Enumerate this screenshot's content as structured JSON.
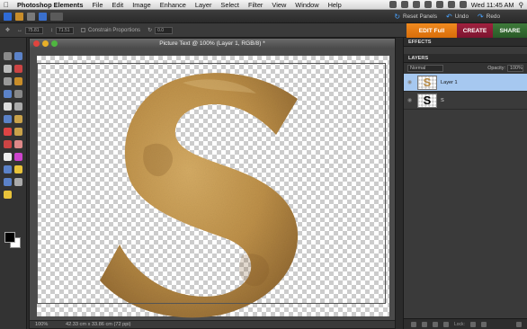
{
  "menubar": {
    "app_name": "Photoshop Elements",
    "items": [
      "File",
      "Edit",
      "Image",
      "Enhance",
      "Layer",
      "Select",
      "Filter",
      "View",
      "Window",
      "Help"
    ],
    "clock": "Wed 11:45 AM"
  },
  "appbar": {
    "reset_panels": "Reset Panels",
    "undo": "Undo",
    "redo": "Redo"
  },
  "optionsbar": {
    "width_value": "75.81",
    "height_value": "71.51",
    "constrain_label": "Constrain Proportions",
    "angle_value": "0.0"
  },
  "modes": {
    "edit": "EDIT Full",
    "create": "CREATE",
    "share": "SHARE"
  },
  "document": {
    "title": "Picture Text @ 100% (Layer 1, RGB/8) *",
    "zoom": "100%",
    "size_info": "42.33 cm x 33.86 cm (72 ppi)"
  },
  "panel": {
    "effects_tab": "EFFECTS",
    "layers_tab": "LAYERS",
    "blend_mode": "Normal",
    "opacity_label": "Opacity:",
    "opacity_value": "100%",
    "layers": [
      {
        "name": "Layer 1",
        "active": true
      },
      {
        "name": "S",
        "active": false
      }
    ],
    "lock_label": "Lock:"
  },
  "colors": {
    "edit_accent": "#e57b12",
    "create_accent": "#8c1a37",
    "share_accent": "#336b30",
    "layer_highlight": "#a6c8f0"
  }
}
